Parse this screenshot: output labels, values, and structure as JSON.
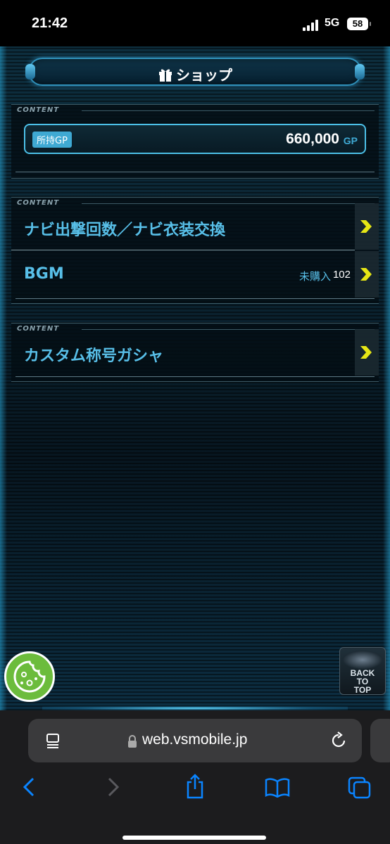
{
  "status_bar": {
    "time": "21:42",
    "network": "5G",
    "battery": "58"
  },
  "header": {
    "title": "ショップ",
    "icon": "gift-icon"
  },
  "gp_panel": {
    "section_label": "CONTENT",
    "gp_tag": "所持GP",
    "gp_value": "660,000",
    "gp_unit": "GP"
  },
  "menu_panel_1": {
    "section_label": "CONTENT",
    "items": [
      {
        "label": "ナビ出撃回数／ナビ衣装交換",
        "status": "",
        "count": ""
      },
      {
        "label": "BGM",
        "status": "未購入",
        "count": "102"
      }
    ]
  },
  "menu_panel_2": {
    "section_label": "CONTENT",
    "items": [
      {
        "label": "カスタム称号ガシャ"
      }
    ]
  },
  "floating": {
    "back_to_top_line1": "BACK",
    "back_to_top_line2": "TO",
    "back_to_top_line3": "TOP"
  },
  "browser": {
    "url": "web.vsmobile.jp"
  },
  "colors": {
    "accent": "#58bfe8",
    "arrow": "#e6e615",
    "cookie": "#6cbc3c"
  }
}
